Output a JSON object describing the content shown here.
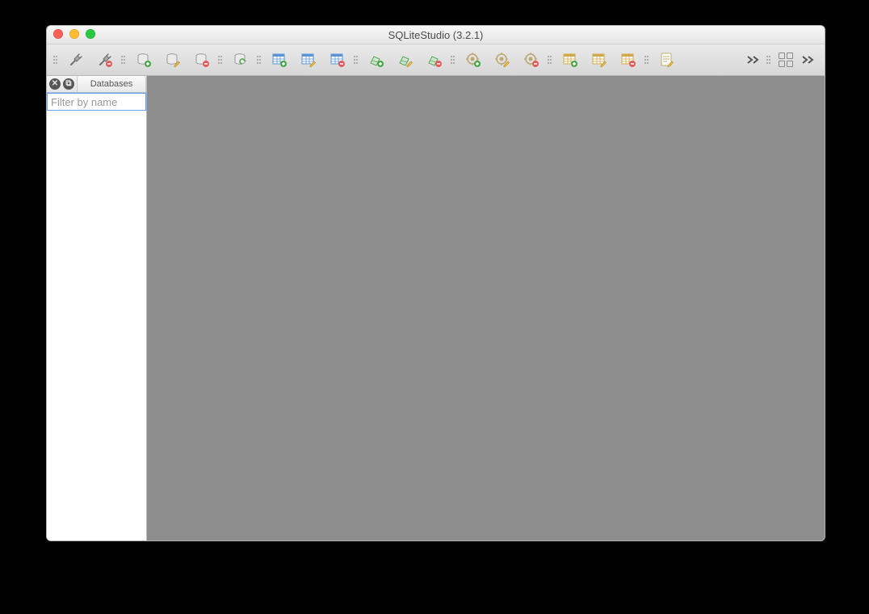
{
  "window": {
    "title": "SQLiteStudio (3.2.1)"
  },
  "sidebar": {
    "tab_label": "Databases",
    "filter_placeholder": "Filter by name"
  },
  "toolbar": {
    "groups": [
      [
        "connect",
        "disconnect"
      ],
      [
        "add-database",
        "edit-database",
        "remove-database"
      ],
      [
        "refresh-database"
      ],
      [
        "create-table",
        "edit-table",
        "delete-table"
      ],
      [
        "create-index",
        "edit-index",
        "delete-index"
      ],
      [
        "create-trigger",
        "edit-trigger",
        "delete-trigger"
      ],
      [
        "create-view",
        "edit-view",
        "delete-view"
      ],
      [
        "open-sql-editor"
      ]
    ]
  }
}
